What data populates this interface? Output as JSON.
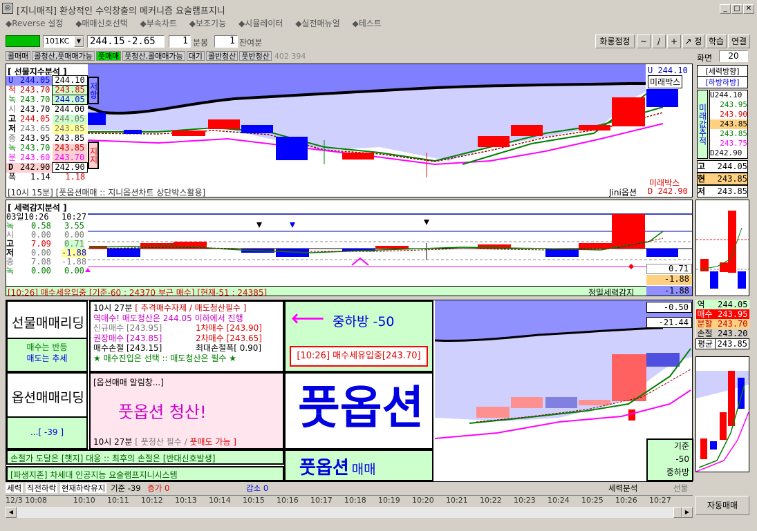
{
  "window": {
    "title": "[지니매직] 환상적인 수익창출의 메커니즘 요술램프지니"
  },
  "menu": [
    "◆Reverse 설정",
    "◆매매신호선택",
    "◆부속차트",
    "◆보조기능",
    "◆시뮬레이터",
    "◆실전매뉴얼",
    "◆테스트"
  ],
  "toolbar": {
    "code": "101KC",
    "price": "244.15",
    "change": "-2.65",
    "bong_value": "1",
    "bong_label": "분봉",
    "remain_value": "1",
    "remain_label": "잔여분",
    "fix_button": "화롱점정",
    "tool_buttons": [
      "~",
      "/",
      "+",
      "↗ 정"
    ],
    "study_button": "학습",
    "link_button": "연결",
    "screen_label": "화면",
    "screen_value": "20"
  },
  "status_tags": [
    "콜매매",
    "콜청산,풋매매가능",
    "풋매매",
    "풋청산,콜매매가능",
    "대기",
    "콜반청산",
    "풋반청산"
  ],
  "status_code": "402 394",
  "futures": {
    "title": "[ 선물지수분석 ]",
    "rows": [
      {
        "label": "U",
        "a": "244.05",
        "b": "244.10"
      },
      {
        "label": "적",
        "a": "243.70",
        "b": "243.85"
      },
      {
        "label": "녹",
        "a": "243.70",
        "b": "244.05"
      },
      {
        "label": "시",
        "a": "243.70",
        "b": "244.00"
      },
      {
        "label": "고",
        "a": "244.05",
        "b": "244.05"
      },
      {
        "label": "저",
        "a": "243.65",
        "b": "243.85"
      },
      {
        "label": "종",
        "a": "243.95",
        "b": "243.85"
      },
      {
        "label": "녹",
        "a": "243.70",
        "b": "243.85"
      },
      {
        "label": "분",
        "a": "243.60",
        "b": "243.70"
      },
      {
        "label": "D",
        "a": "242.90",
        "b": "242.90"
      },
      {
        "label": "폭",
        "a": "1.14",
        "b": "1.18"
      }
    ],
    "resist_label": "저항",
    "support_label": "지지",
    "right_u": "U 244.10",
    "right_box": "미래박스",
    "bottom_box": "미래박스",
    "bottom_d": "D 242.90",
    "footer_left": "[10시 15분] [풋옵션매매 :: 지니옵션차트 상단박스활용]",
    "footer_right": "Jini옵션"
  },
  "direction": {
    "title": "[세력방향]",
    "value": "[하방하방]",
    "vertical": "미래값추적",
    "values": [
      "U244.10",
      "243.95",
      "243.90",
      "243.85",
      "243.85",
      "243.75",
      "D242.90"
    ],
    "high_label": "고",
    "high": "244.05",
    "cur_label": "현",
    "cur": "243.85",
    "low_label": "저",
    "low": "243.85"
  },
  "power": {
    "title": "[ 세력감지분석 ]",
    "time_a": "03일10:26",
    "time_b": "10:27",
    "rows": [
      {
        "label": "녹",
        "a": "0.58",
        "b": "3.55"
      },
      {
        "label": "시",
        "a": "0.00",
        "b": "0.00"
      },
      {
        "label": "고",
        "a": "7.09",
        "b": "0.71"
      },
      {
        "label": "저",
        "a": "0.00",
        "b": "-1.88"
      },
      {
        "label": "종",
        "a": "7.08",
        "b": "-1.88"
      },
      {
        "label": "녹",
        "a": "0.00",
        "b": "0.00"
      }
    ],
    "right_vals": [
      "0.71",
      "-1.88",
      "-1.88"
    ],
    "footer": "[10:26] 매수세유입중 [기준-60 : 24370 부근 매수] [현재-51 : 24385]",
    "footer_right": "정밀세력감지"
  },
  "leading": {
    "futures_title": "선물매매리딩",
    "futures_sub1": "매수는 반등",
    "futures_sub2": "매도는 추세",
    "time_line": "10시 27분",
    "time_bracket": "[ 추격매수자제 / 매도청산필수 ]",
    "line1": "역매수! 매도청산은 244.05 이하에서 진행",
    "line2a": "신규매수 [243.95]",
    "line2b": "1차매수 [243.90]",
    "line3a": "권장매수 [243.85]",
    "line3b": "2차매수 [243.65]",
    "line4a": "매수손절 [243.15]",
    "line4b": "최대손절폭[ 0.90]",
    "line5": "★ 매수진입은 선택 :: 매도청산은 필수 ★",
    "arrow_text": "중하방 -50",
    "alert_box": "[10:26] 매수세유입중[243.70]",
    "option_title": "옵션매매리딩",
    "option_sub": "...[ -39 ]",
    "option_alert": "[옵션매매 알림창...]",
    "option_msg": "풋옵션 청산!",
    "option_time": "10시 27분",
    "option_bracket_a": "[ 풋청산 필수 /",
    "option_bracket_b": "풋매도 가능 ]",
    "big_text": "풋옵션",
    "big_sub_a": "풋옵션",
    "big_sub_b": "매매",
    "rule1": "손절가 도달은 [햇지] 대응 :: 최후의 손절은 [반대신호발생]",
    "rule2": "[파생지존] 차세대 인공지능 요술램프지니시스템",
    "right_vals": [
      "-0.50",
      "-21.44"
    ],
    "base_box": [
      "기준",
      "-50",
      "중하방"
    ]
  },
  "option_side": {
    "rows": [
      {
        "label": "역",
        "val": "244.05"
      },
      {
        "label": "매수",
        "val": "243.95"
      },
      {
        "label": "분할",
        "val": "243.70"
      },
      {
        "label": "손절",
        "val": "243.20"
      },
      {
        "label": "평균",
        "val": "243.85"
      }
    ]
  },
  "bottom_status": {
    "items": [
      "세력",
      "직전하락",
      "현재하락유지",
      "기준 -39",
      "증가 0",
      "감소 0",
      "세력분석",
      "선물"
    ]
  },
  "timeline": [
    "12/3 10:08",
    "10:10",
    "10:11",
    "10:12",
    "10:13",
    "10:14",
    "10:15",
    "10:16",
    "10:17",
    "10:18",
    "10:19",
    "10:20",
    "10:21",
    "10:22",
    "10:23",
    "10:24",
    "10:25",
    "10:26",
    "10:27"
  ],
  "auto_button": "자동매매",
  "colors": {
    "green_box": "#00c000",
    "lav": "#9090ff",
    "light_green": "#ccffcc",
    "red": "#ff0000",
    "blue": "#0000ff"
  }
}
